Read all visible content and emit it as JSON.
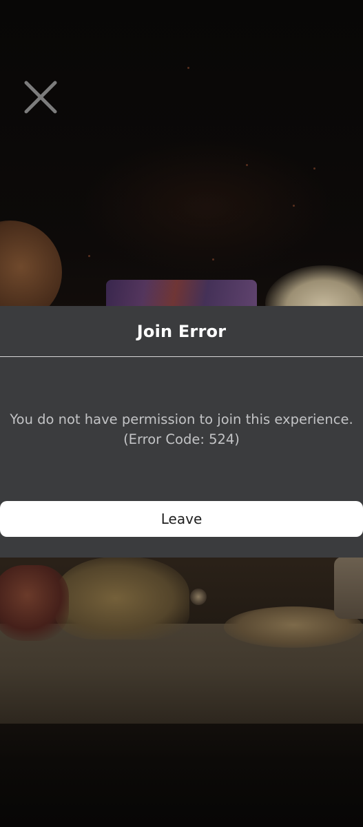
{
  "close_button": {
    "icon": "close-icon"
  },
  "dialog": {
    "title": "Join Error",
    "message_line1": "You do not have permission to join this experience.",
    "message_line2": "(Error Code: 524)",
    "leave_label": "Leave"
  },
  "colors": {
    "dialog_background": "#3b3c3e",
    "title_text": "#ffffff",
    "message_text": "#c3c4c6",
    "button_background": "#ffffff",
    "button_text": "#1e1e1e",
    "divider": "#d8d8d8"
  }
}
